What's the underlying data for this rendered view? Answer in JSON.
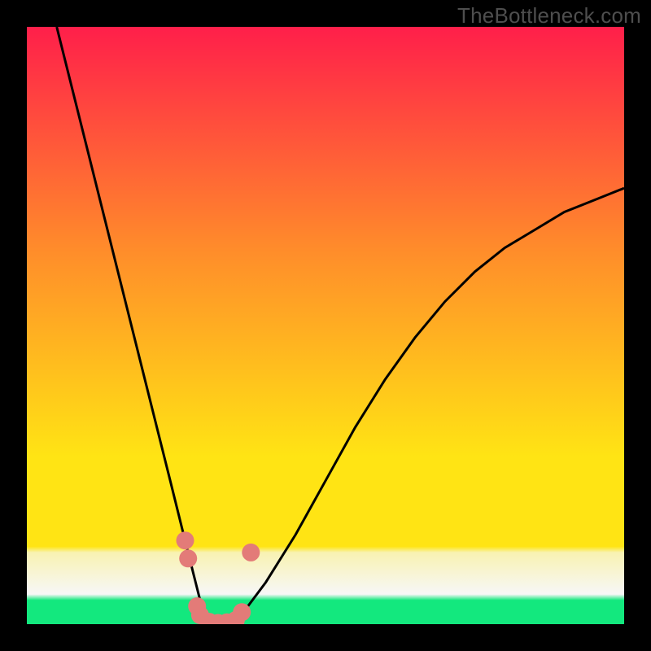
{
  "watermark": "TheBottleneck.com",
  "colors": {
    "frame": "#000000",
    "watermark_text": "#4e4e4e",
    "curve_stroke": "#000000",
    "marker_fill": "#e37b78",
    "gradient_top": "#ff1f4a",
    "gradient_mid_upper": "#ff8e2a",
    "gradient_mid": "#ffe414",
    "gradient_band_top": "#f8f2b2",
    "gradient_band_bottom": "#f7f7f7",
    "gradient_bottom_stripe": "#13e87e"
  },
  "chart_data": {
    "type": "line",
    "title": "",
    "xlabel": "",
    "ylabel": "",
    "xlim": [
      0,
      100
    ],
    "ylim": [
      0,
      100
    ],
    "grid": false,
    "legend": false,
    "series": [
      {
        "name": "bottleneck-curve",
        "x": [
          5,
          10,
          15,
          20,
          22,
          24,
          26,
          28,
          29,
          30,
          31,
          32,
          33,
          34,
          35,
          37,
          40,
          45,
          50,
          55,
          60,
          65,
          70,
          75,
          80,
          85,
          90,
          95,
          100
        ],
        "y": [
          100,
          80,
          60,
          40,
          32,
          24,
          16,
          8,
          4,
          1,
          0,
          0,
          0,
          0.5,
          1,
          3,
          7,
          15,
          24,
          33,
          41,
          48,
          54,
          59,
          63,
          66,
          69,
          71,
          73
        ]
      }
    ],
    "markers": [
      {
        "name": "left-dot-upper",
        "x": 26.5,
        "y": 14
      },
      {
        "name": "left-dot-mid",
        "x": 27.0,
        "y": 11
      },
      {
        "name": "left-dot-low1",
        "x": 28.5,
        "y": 3
      },
      {
        "name": "left-dot-low2",
        "x": 29.0,
        "y": 1.5
      },
      {
        "name": "bottom-dot-1",
        "x": 30.5,
        "y": 0.4
      },
      {
        "name": "bottom-dot-2",
        "x": 32.0,
        "y": 0.2
      },
      {
        "name": "bottom-dot-3",
        "x": 33.5,
        "y": 0.3
      },
      {
        "name": "bottom-dot-4",
        "x": 35.0,
        "y": 0.7
      },
      {
        "name": "right-dot-low",
        "x": 36.0,
        "y": 2
      },
      {
        "name": "right-dot-upper",
        "x": 37.5,
        "y": 12
      }
    ]
  }
}
